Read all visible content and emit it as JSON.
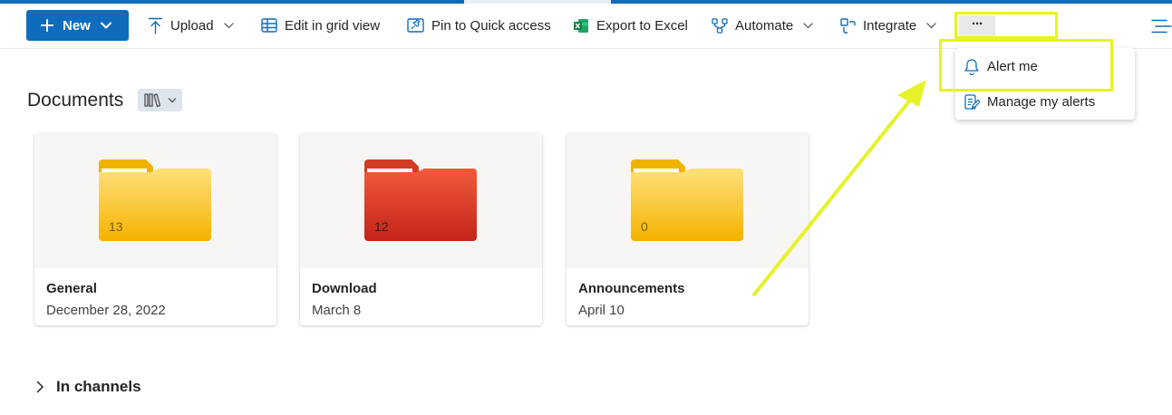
{
  "toolbar": {
    "new_label": "New",
    "upload_label": "Upload",
    "grid_label": "Edit in grid view",
    "pin_label": "Pin to Quick access",
    "export_label": "Export to Excel",
    "automate_label": "Automate",
    "integrate_label": "Integrate",
    "more_label": "···"
  },
  "menu": {
    "items": [
      {
        "label": "Alert me",
        "icon": "bell-icon"
      },
      {
        "label": "Manage my alerts",
        "icon": "manage-alerts-icon"
      }
    ]
  },
  "library": {
    "title": "Documents",
    "view_icon": "library-view-icon"
  },
  "folders": [
    {
      "name": "General",
      "date": "December 28, 2022",
      "count": "13",
      "color": "#f7c544"
    },
    {
      "name": "Download",
      "date": "March 8",
      "count": "12",
      "color": "#e13a25"
    },
    {
      "name": "Announcements",
      "date": "April 10",
      "count": "0",
      "color": "#f7c544"
    }
  ],
  "sections": {
    "channels_label": "In channels"
  },
  "colors": {
    "accent": "#0f6cbd",
    "highlight": "#e6f22a",
    "excel_green": "#107c41"
  }
}
